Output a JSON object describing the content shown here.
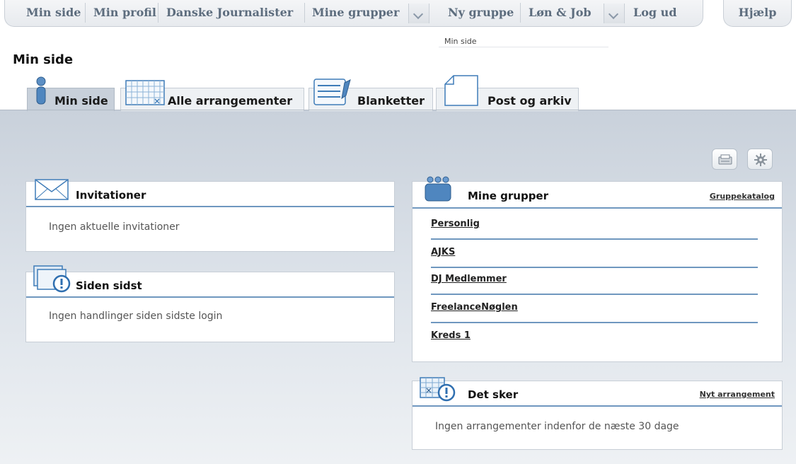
{
  "nav": {
    "items": [
      "Min side",
      "Min profil",
      "Danske Journalister",
      "Mine grupper",
      "Ny gruppe",
      "Løn & Job",
      "Log ud"
    ],
    "help": "Hjælp"
  },
  "breadcrumb": "Min side",
  "page_title": "Min side",
  "tabs": [
    {
      "label": "Min side",
      "icon": "person-icon",
      "active": true
    },
    {
      "label": "Alle arrangementer",
      "icon": "calendar-icon",
      "active": false
    },
    {
      "label": "Blanketter",
      "icon": "form-icon",
      "active": false
    },
    {
      "label": "Post og arkiv",
      "icon": "document-icon",
      "active": false
    }
  ],
  "toolbar": {
    "print_icon": "print-icon",
    "settings_icon": "gear-icon"
  },
  "invitations": {
    "title": "Invitationer",
    "icon": "envelope-icon",
    "empty_text": "Ingen aktuelle invitationer"
  },
  "since_last": {
    "title": "Siden sidst",
    "icon": "alert-window-icon",
    "empty_text": "Ingen handlinger siden sidste login"
  },
  "groups": {
    "title": "Mine grupper",
    "icon": "group-icon",
    "link": "Gruppekatalog",
    "items": [
      "Personlig",
      "AJKS",
      "DJ Medlemmer",
      "FreelanceNøglen",
      "Kreds 1"
    ]
  },
  "events": {
    "title": "Det sker",
    "icon": "calendar-alert-icon",
    "link": "Nyt arrangement",
    "empty_text": "Ingen arrangementer indenfor de næste 30 dage"
  },
  "colors": {
    "accent_line": "#6f97bf",
    "nav_text": "#5d6d7e",
    "background_top": "#c9d1db"
  }
}
